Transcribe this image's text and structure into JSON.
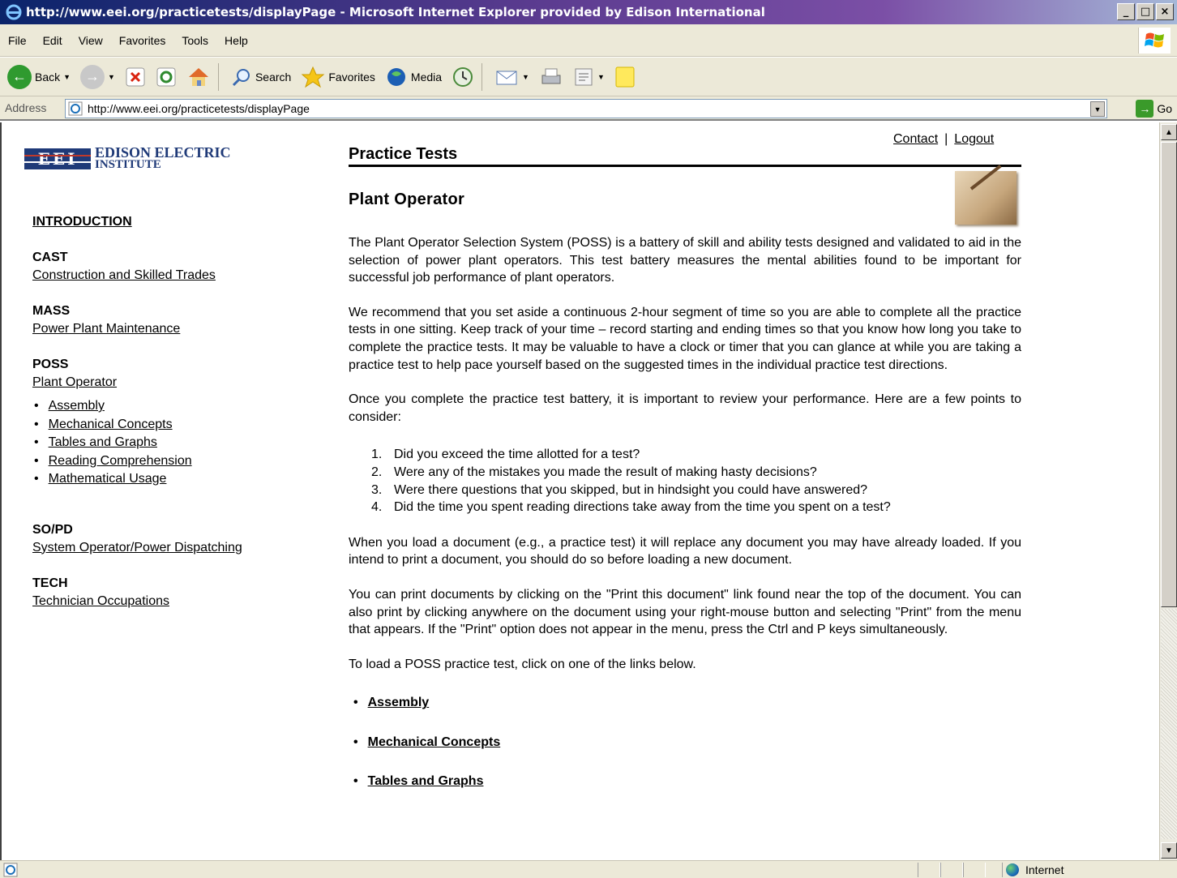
{
  "window": {
    "title": "http://www.eei.org/practicetests/displayPage - Microsoft Internet Explorer provided by Edison International",
    "controls": [
      "_",
      "□",
      "×"
    ]
  },
  "menu": [
    "File",
    "Edit",
    "View",
    "Favorites",
    "Tools",
    "Help"
  ],
  "toolbar": {
    "back_label": "Back",
    "search_label": "Search",
    "favorites_label": "Favorites",
    "media_label": "Media"
  },
  "address": {
    "label": "Address",
    "url": "http://www.eei.org/practicetests/displayPage",
    "go_label": "Go"
  },
  "logo": {
    "mark": "EEI",
    "line1": "EDISON ELECTRIC",
    "line2": "INSTITUTE"
  },
  "nav": {
    "introduction": "INTRODUCTION",
    "sections": [
      {
        "heading": "CAST",
        "link": "Construction and Skilled Trades"
      },
      {
        "heading": "MASS",
        "link": "Power Plant Maintenance"
      },
      {
        "heading": "POSS",
        "link": "Plant Operator",
        "subitems": [
          "Assembly",
          "Mechanical Concepts",
          "Tables and Graphs",
          "Reading Comprehension",
          "Mathematical Usage"
        ]
      },
      {
        "heading": "SO/PD",
        "link": "System Operator/Power Dispatching"
      },
      {
        "heading": "TECH",
        "link": "Technician Occupations"
      }
    ]
  },
  "header": {
    "contact": "Contact",
    "separator": "|",
    "logout": "Logout",
    "title": "Practice Tests",
    "subtitle": "Plant Operator"
  },
  "content": {
    "p1": "The Plant Operator Selection System (POSS) is a battery of skill and ability tests designed and validated to aid in the selection of power plant operators. This test battery measures the mental abilities found to be important for successful job performance of plant operators.",
    "p2": "We recommend that you set aside a continuous 2-hour segment of time so you are able to complete all the practice tests in one sitting. Keep track of your time – record starting and ending times so that you know how long you take to complete the practice tests. It may be valuable to have a clock or timer that you can glance at while you are taking a practice test to help pace yourself based on the suggested times in the individual practice test directions.",
    "p3": "Once you complete the practice test battery, it is important to review your performance. Here are a few points to consider:",
    "points": [
      "Did you exceed the time allotted for a test?",
      "Were any of the mistakes you made the result of making hasty decisions?",
      "Were there questions that you skipped, but in hindsight you could have answered?",
      "Did the time you spent reading directions take away from the time you spent on a test?"
    ],
    "p4": "When you load a document (e.g., a practice test) it will replace any document you may have already loaded. If you intend to print a document, you should do so before loading a new document.",
    "p5": "You can print documents by clicking on the \"Print this document\" link found near the top of the document. You can also print by clicking anywhere on the document using your right-mouse button and selecting \"Print\" from the menu that appears. If the \"Print\" option does not appear in the menu, press the Ctrl and P keys simultaneously.",
    "p6": "To load a POSS practice test, click on one of the links below.",
    "tests": [
      "Assembly",
      "Mechanical Concepts",
      "Tables and Graphs"
    ]
  },
  "status": {
    "zone": "Internet"
  }
}
